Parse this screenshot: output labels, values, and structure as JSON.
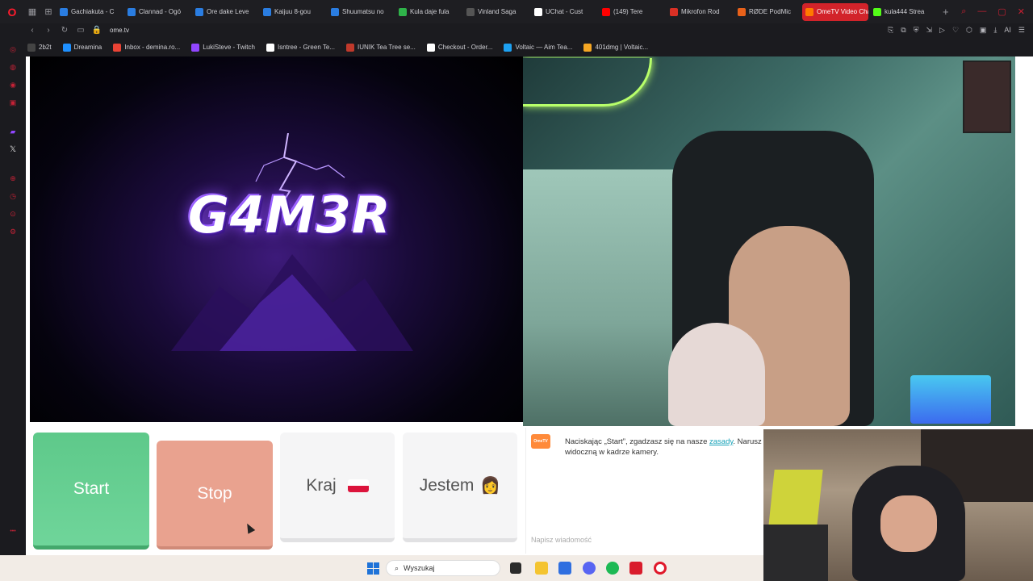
{
  "browser": {
    "tabs": [
      {
        "label": "Gachiakuta - C",
        "color": "#2a7de1"
      },
      {
        "label": "Clannad - Ogó",
        "color": "#2a7de1"
      },
      {
        "label": "Ore dake Leve",
        "color": "#2a7de1"
      },
      {
        "label": "Kaijuu 8-gou",
        "color": "#2a7de1"
      },
      {
        "label": "Shuumatsu no",
        "color": "#2a7de1"
      },
      {
        "label": "Kula daje fula",
        "color": "#2fb34a"
      },
      {
        "label": "Vinland Saga",
        "color": "#555555"
      },
      {
        "label": "UChat - Cust",
        "color": "#ffffff"
      },
      {
        "label": "(149) Tere",
        "color": "#ff0000"
      },
      {
        "label": "Mikrofon Rod",
        "color": "#d93025"
      },
      {
        "label": "RØDE PodMic",
        "color": "#e8611a"
      },
      {
        "label": "OmeTV Video Chat -",
        "color": "#ff7a00",
        "active": true
      },
      {
        "label": "kula444 Strea",
        "color": "#53fc18"
      }
    ],
    "url": "ome.tv",
    "bookmarks": [
      {
        "label": "2b2t",
        "color": "#444444"
      },
      {
        "label": "Dreamina",
        "color": "#1e90ff"
      },
      {
        "label": "Inbox - demina.ro...",
        "color": "#ea4335"
      },
      {
        "label": "LukiSteve - Twitch",
        "color": "#9146ff"
      },
      {
        "label": "Isntree - Green Te...",
        "color": "#ffffff"
      },
      {
        "label": "IUNIK Tea Tree se...",
        "color": "#c0392b"
      },
      {
        "label": "Checkout - Order...",
        "color": "#ffffff"
      },
      {
        "label": "Voltaic — Aim Tea...",
        "color": "#1da1f2"
      },
      {
        "label": "401dmg | Voltaic...",
        "color": "#f5a623"
      }
    ]
  },
  "video": {
    "left_logo_text": "G4M3R"
  },
  "controls": {
    "start_label": "Start",
    "stop_label": "Stop",
    "country_label": "Kraj",
    "gender_label": "Jestem",
    "gender_emoji": "👩"
  },
  "chat": {
    "logo_text": "OmeTV",
    "msg_before_link": "Naciskając „Start”, zgadzasz się na nasze ",
    "msg_link": "zasady",
    "msg_after_link": ". Narusz",
    "msg_line2": "widoczną w kadrze kamery.",
    "input_placeholder": "Napisz wiadomość"
  },
  "taskbar": {
    "search_placeholder": "Wyszukaj"
  },
  "colors": {
    "opera_red": "#ff1b2d",
    "start_green": "#5ec98a",
    "stop_salmon": "#e9a28f",
    "link_teal": "#17a2b8",
    "windows_blue": "#1f73d8"
  }
}
